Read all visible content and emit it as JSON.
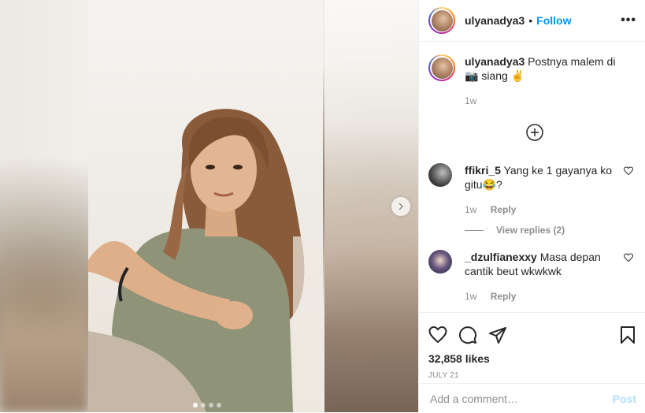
{
  "header": {
    "username": "ulyanadya3",
    "separator": "•",
    "follow_label": "Follow",
    "more_label": "•••"
  },
  "caption": {
    "username": "ulyanadya3",
    "text": "Postnya malem di 📷 siang ✌",
    "time": "1w"
  },
  "comments": [
    {
      "username": "ffikri_5",
      "text": "Yang ke 1 gayanya ko gitu😂?",
      "time": "1w",
      "reply_label": "Reply"
    },
    {
      "username": "_dzulfianexxy",
      "text": "Masa depan cantik beut wkwkwk",
      "time": "1w",
      "reply_label": "Reply"
    }
  ],
  "view_replies": "View replies (2)",
  "likes": "32,858 likes",
  "date": "July 21",
  "add_comment": {
    "placeholder": "Add a comment…",
    "post_label": "Post"
  },
  "carousel": {
    "current": 1,
    "total": 4
  },
  "colors": {
    "accent": "#0095f6",
    "muted": "#8e8e8e",
    "post_disabled": "#b2dffc"
  }
}
